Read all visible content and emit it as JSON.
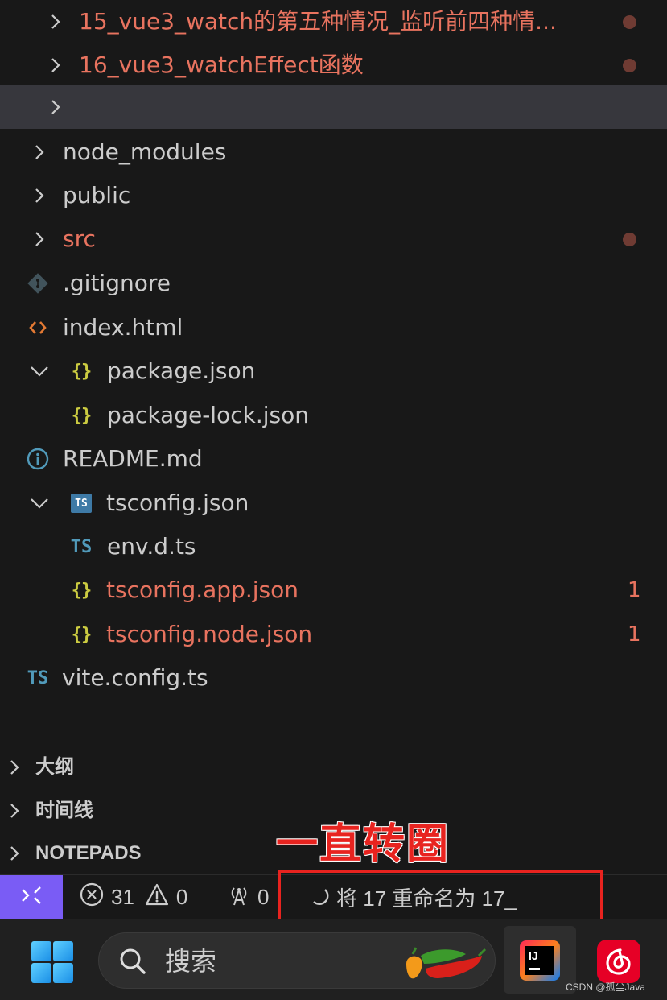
{
  "explorer": {
    "rows": [
      {
        "label": "15_vue3_watch的第五种情况_监听前四种情...",
        "kind": "folder",
        "modified": true,
        "badge": "dot"
      },
      {
        "label": "16_vue3_watchEffect函数",
        "kind": "folder",
        "modified": true,
        "badge": "dot"
      },
      {
        "label": "",
        "kind": "folder-renaming",
        "modified": false,
        "badge": ""
      },
      {
        "label": "node_modules",
        "kind": "folder",
        "modified": false,
        "badge": ""
      },
      {
        "label": "public",
        "kind": "folder",
        "modified": false,
        "badge": ""
      },
      {
        "label": "src",
        "kind": "folder",
        "modified": true,
        "badge": "dot"
      },
      {
        "label": ".gitignore",
        "kind": "file",
        "icon": "git-icon"
      },
      {
        "label": "index.html",
        "kind": "file",
        "icon": "html-icon"
      },
      {
        "label": "package.json",
        "kind": "nested-parent",
        "icon": "json-icon"
      },
      {
        "label": "package-lock.json",
        "kind": "nested-child",
        "icon": "json-icon"
      },
      {
        "label": "README.md",
        "kind": "file",
        "icon": "info-icon"
      },
      {
        "label": "tsconfig.json",
        "kind": "nested-parent",
        "icon": "tsconfig-icon"
      },
      {
        "label": "env.d.ts",
        "kind": "nested-child",
        "icon": "ts-icon"
      },
      {
        "label": "tsconfig.app.json",
        "kind": "nested-child",
        "icon": "json-icon",
        "modified": true,
        "count": "1"
      },
      {
        "label": "tsconfig.node.json",
        "kind": "nested-child",
        "icon": "json-icon",
        "modified": true,
        "count": "1"
      },
      {
        "label": "vite.config.ts",
        "kind": "file",
        "icon": "ts-icon"
      }
    ],
    "icon_text": {
      "json": "{}",
      "ts": "TS"
    }
  },
  "sections": {
    "outline": "大纲",
    "timeline": "时间线",
    "notepads": "NOTEPADS"
  },
  "annotation": "一直转圈",
  "statusbar": {
    "errors": "31",
    "warnings": "0",
    "ports": "0",
    "progress_text": "将 17 重命名为 17_"
  },
  "taskbar": {
    "search_placeholder": "搜索",
    "ij_label": "IJ"
  },
  "watermark": "CSDN @孤尘Java",
  "colors": {
    "modified": "#e8735f",
    "remote_accent": "#7a5cf5",
    "annotation_red": "#e8231f",
    "json_icon": "#cbcb41",
    "ts_icon": "#519aba"
  }
}
